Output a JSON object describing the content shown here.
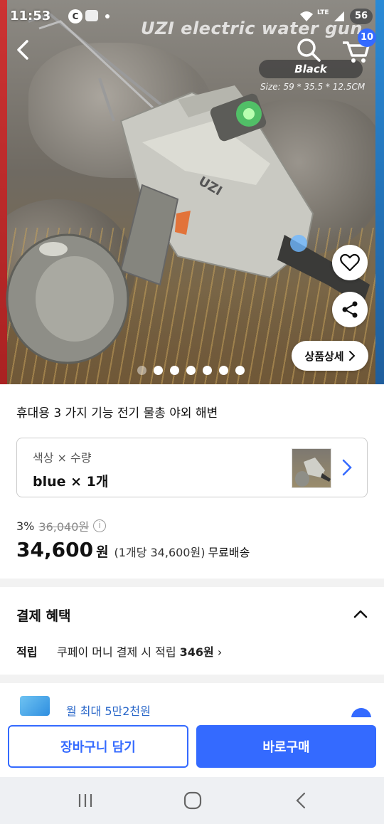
{
  "status_bar": {
    "time": "11:53",
    "app_letter": "C",
    "lte": "LTE",
    "battery": "56"
  },
  "hero": {
    "title": "UZI electric water gun",
    "color_tag": "Black",
    "size_text": "Size: 59 * 35.5 * 12.5CM",
    "cart_count": "10",
    "detail_button": "상품상세",
    "slide_count": 7,
    "active_slide": 0
  },
  "product": {
    "title": "휴대용 3 가지 기능 전기 물총 야외 해변",
    "option_label": "색상 × 수량",
    "option_value": "blue × 1개",
    "discount_rate": "3%",
    "original_price": "36,040원",
    "price": "34,600",
    "price_unit": "원",
    "unit_price": "(1개당 34,600원)",
    "shipping": "무료배송"
  },
  "benefits": {
    "title": "결제 혜택",
    "reward_label": "적립",
    "reward_text": "쿠페이 머니 결제 시 적립",
    "reward_amount": "346원",
    "card_text": "월 최대 5만2천원"
  },
  "actions": {
    "add_to_cart": "장바구니 담기",
    "buy_now": "바로구매"
  },
  "colors": {
    "accent": "#346aff",
    "card_text": "#2a67c9"
  }
}
